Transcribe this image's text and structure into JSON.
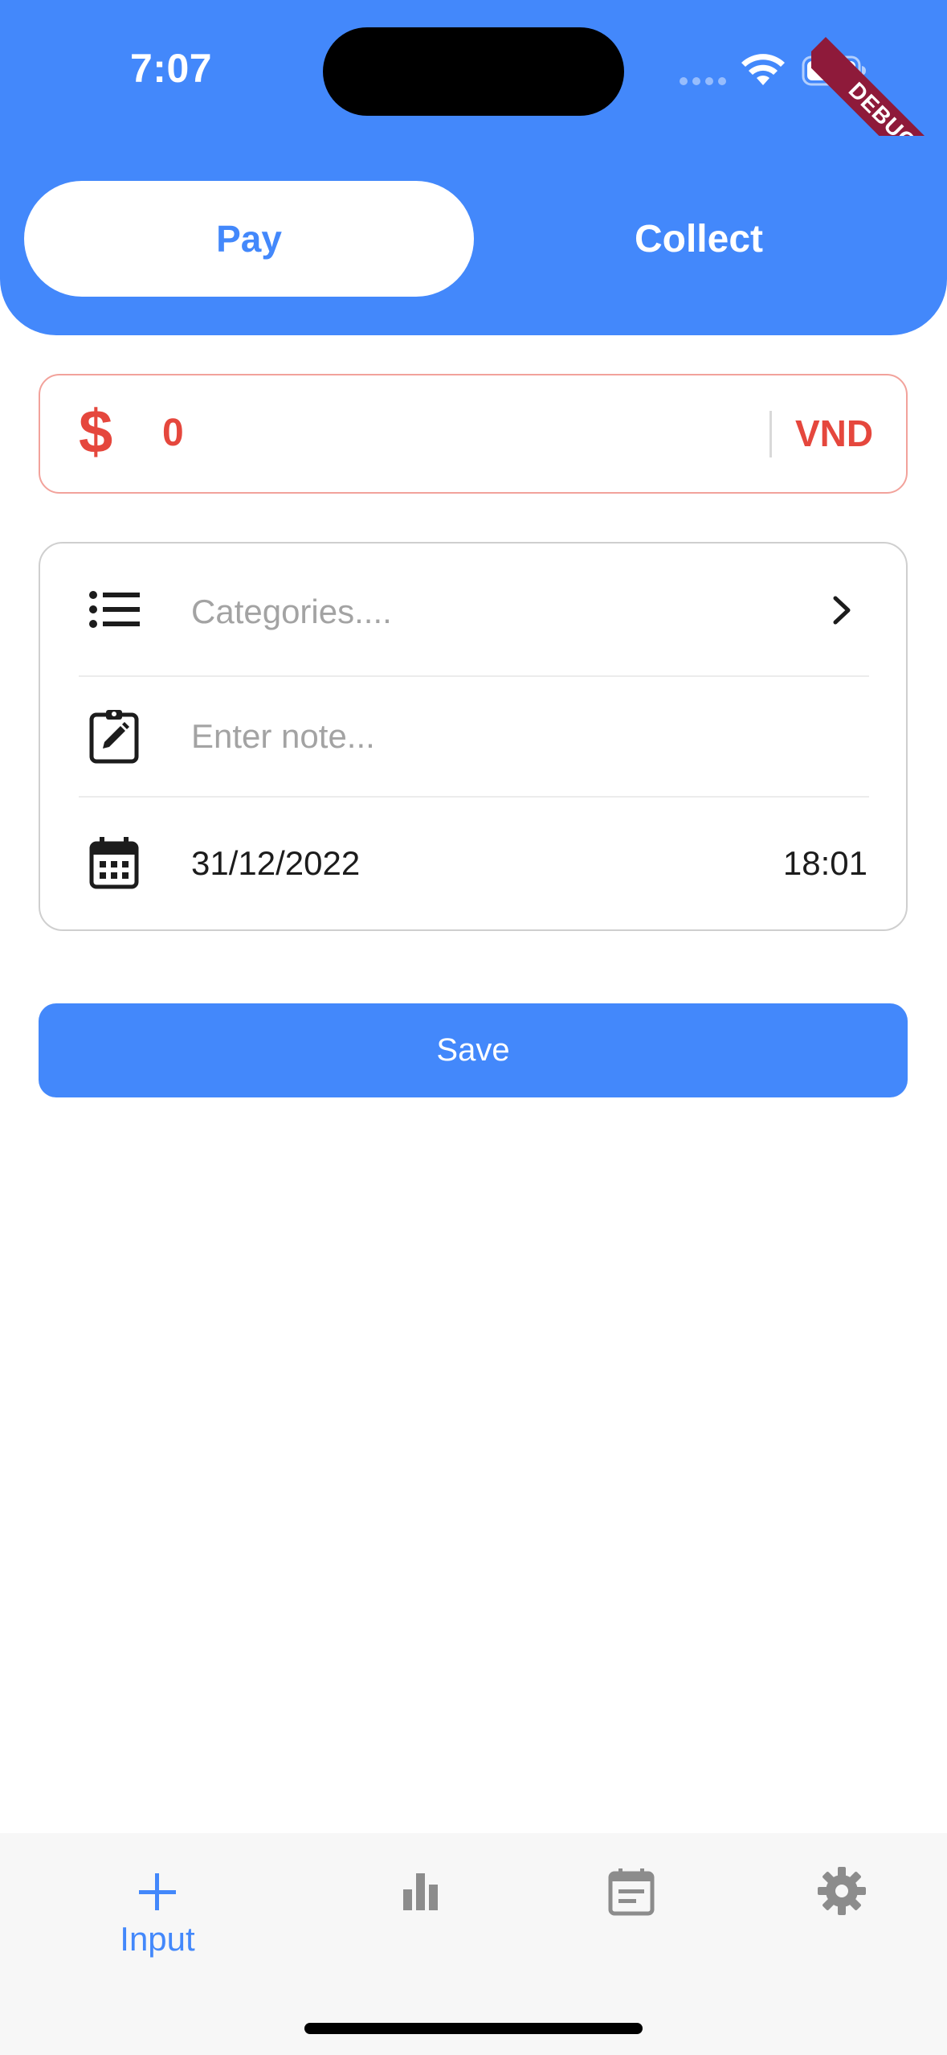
{
  "status_bar": {
    "time": "7:07",
    "debug_label": "DEBUG"
  },
  "tabs": {
    "pay_label": "Pay",
    "collect_label": "Collect",
    "selected": "Pay"
  },
  "amount": {
    "currency_symbol": "$",
    "value": "0",
    "currency": "VND"
  },
  "details": {
    "categories_placeholder": "Categories....",
    "note_placeholder": "Enter note...",
    "date": "31/12/2022",
    "time": "18:01"
  },
  "save_label": "Save",
  "bottom_nav": {
    "items": [
      {
        "label": "Input",
        "icon": "plus-icon",
        "active": true
      },
      {
        "label": "",
        "icon": "bar-chart-icon",
        "active": false
      },
      {
        "label": "",
        "icon": "calendar-note-icon",
        "active": false
      },
      {
        "label": "",
        "icon": "gear-icon",
        "active": false
      }
    ]
  },
  "colors": {
    "primary": "#4388FB",
    "expense_red": "#E5473D",
    "inactive_icon": "#8c8c8c"
  }
}
